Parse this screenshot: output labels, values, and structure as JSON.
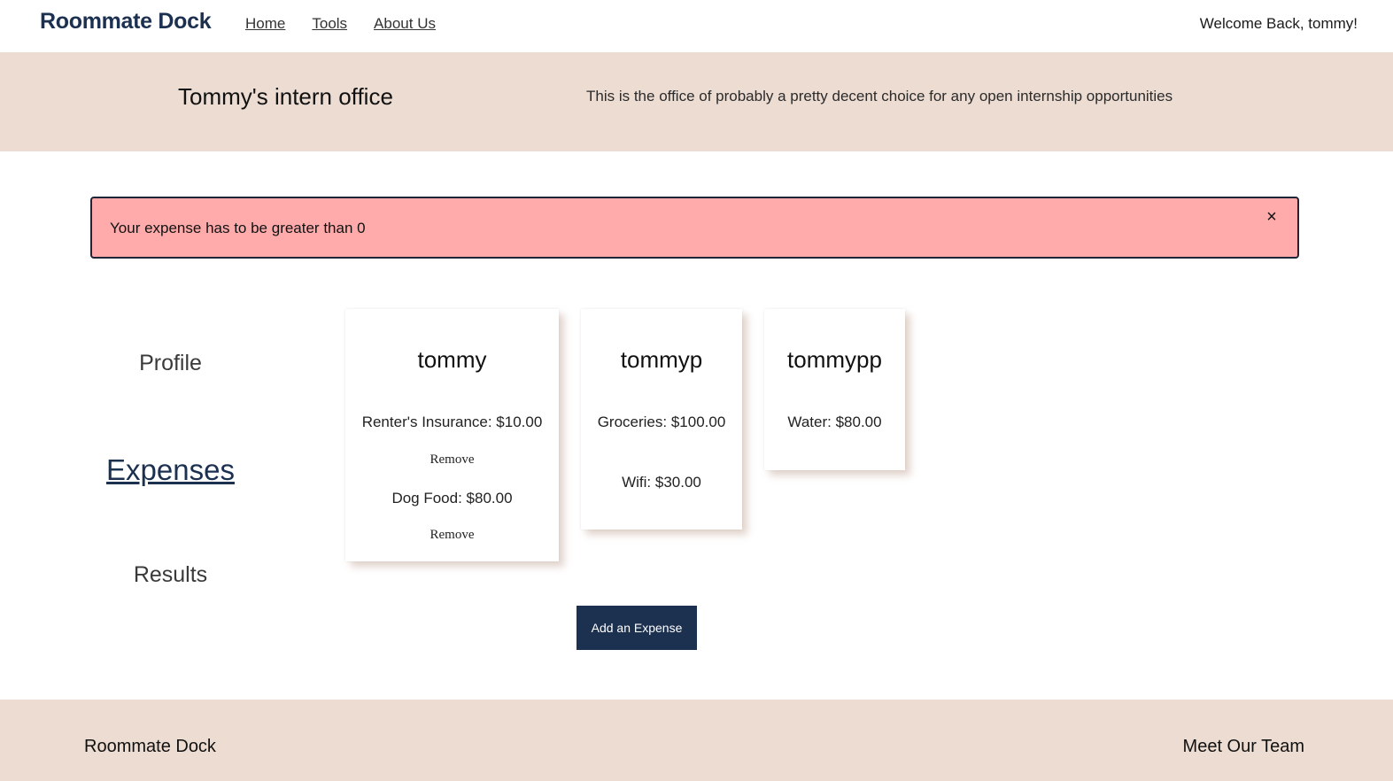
{
  "nav": {
    "brand": "Roommate Dock",
    "links": [
      "Home",
      "Tools",
      "About Us"
    ],
    "welcome": "Welcome Back, tommy!"
  },
  "office": {
    "title": "Tommy's intern office",
    "description": "This is the office of probably a pretty decent choice for any open internship opportunities"
  },
  "alert": {
    "message": "Your expense has to be greater than 0",
    "close_icon": "×"
  },
  "side_menu": {
    "items": [
      "Profile",
      "Expenses",
      "Results"
    ],
    "active": "Expenses"
  },
  "cards": [
    {
      "name": "tommy",
      "expenses": [
        {
          "label": "Renter's Insurance: $10.00",
          "action": "Remove"
        },
        {
          "label": "Dog Food: $80.00",
          "action": "Remove"
        }
      ]
    },
    {
      "name": "tommyp",
      "expenses": [
        {
          "label": "Groceries: $100.00"
        },
        {
          "label": "Wifi: $30.00"
        }
      ]
    },
    {
      "name": "tommypp",
      "expenses": [
        {
          "label": "Water: $80.00"
        }
      ]
    }
  ],
  "add_button": "Add an Expense",
  "footer": {
    "brand": "Roommate Dock",
    "team_link": "Meet Our Team"
  },
  "colors": {
    "brand_navy": "#1c3050",
    "band_beige": "#ecdcd2",
    "alert_pink": "#ffabab"
  }
}
